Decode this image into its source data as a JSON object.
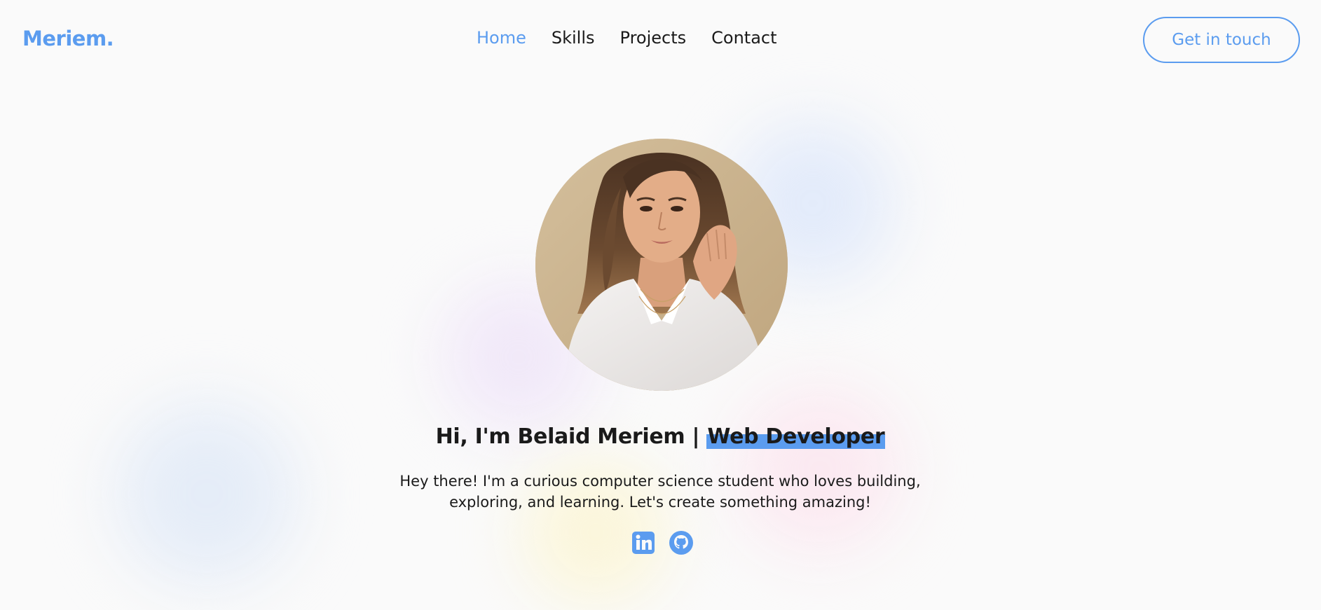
{
  "header": {
    "logo": "Meriem.",
    "nav": [
      {
        "label": "Home",
        "active": true
      },
      {
        "label": "Skills",
        "active": false
      },
      {
        "label": "Projects",
        "active": false
      },
      {
        "label": "Contact",
        "active": false
      }
    ],
    "cta_label": "Get in touch"
  },
  "hero": {
    "title_prefix": "Hi, I'm Belaid Meriem | ",
    "title_role": "Web Developer",
    "description": "Hey there! I'm a curious computer science student who loves building, exploring, and learning. Let's create something amazing!",
    "socials": [
      {
        "icon": "linkedin-icon"
      },
      {
        "icon": "github-icon"
      }
    ]
  },
  "colors": {
    "accent": "#5b9cef",
    "background": "#fafafa",
    "text": "#1a1a1a"
  }
}
